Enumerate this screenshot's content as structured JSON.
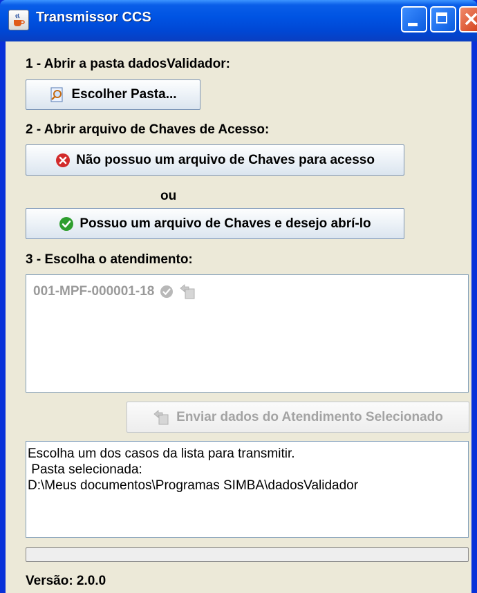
{
  "window": {
    "title": "Transmissor CCS"
  },
  "step1": {
    "label": "1 - Abrir a pasta dadosValidador:",
    "button": "Escolher Pasta..."
  },
  "step2": {
    "label": "2 - Abrir arquivo de Chaves de Acesso:",
    "no_keys_button": "Não possuo um arquivo de Chaves para acesso",
    "or_label": "ou",
    "has_keys_button": "Possuo um arquivo de Chaves e desejo abrí-lo"
  },
  "step3": {
    "label": "3 - Escolha o atendimento:",
    "items": [
      {
        "id": "001-MPF-000001-18"
      }
    ],
    "send_button": "Enviar dados do Atendimento Selecionado"
  },
  "log": {
    "lines": [
      "Escolha um dos casos da lista para transmitir.",
      " Pasta selecionada:",
      "D:\\Meus documentos\\Programas SIMBA\\dadosValidador"
    ]
  },
  "progress": {
    "value": 0
  },
  "footer": {
    "version": "Versão: 2.0.0"
  },
  "colors": {
    "titlebar": "#0054e3",
    "success": "#2e9e2e",
    "error": "#d22b2b"
  }
}
